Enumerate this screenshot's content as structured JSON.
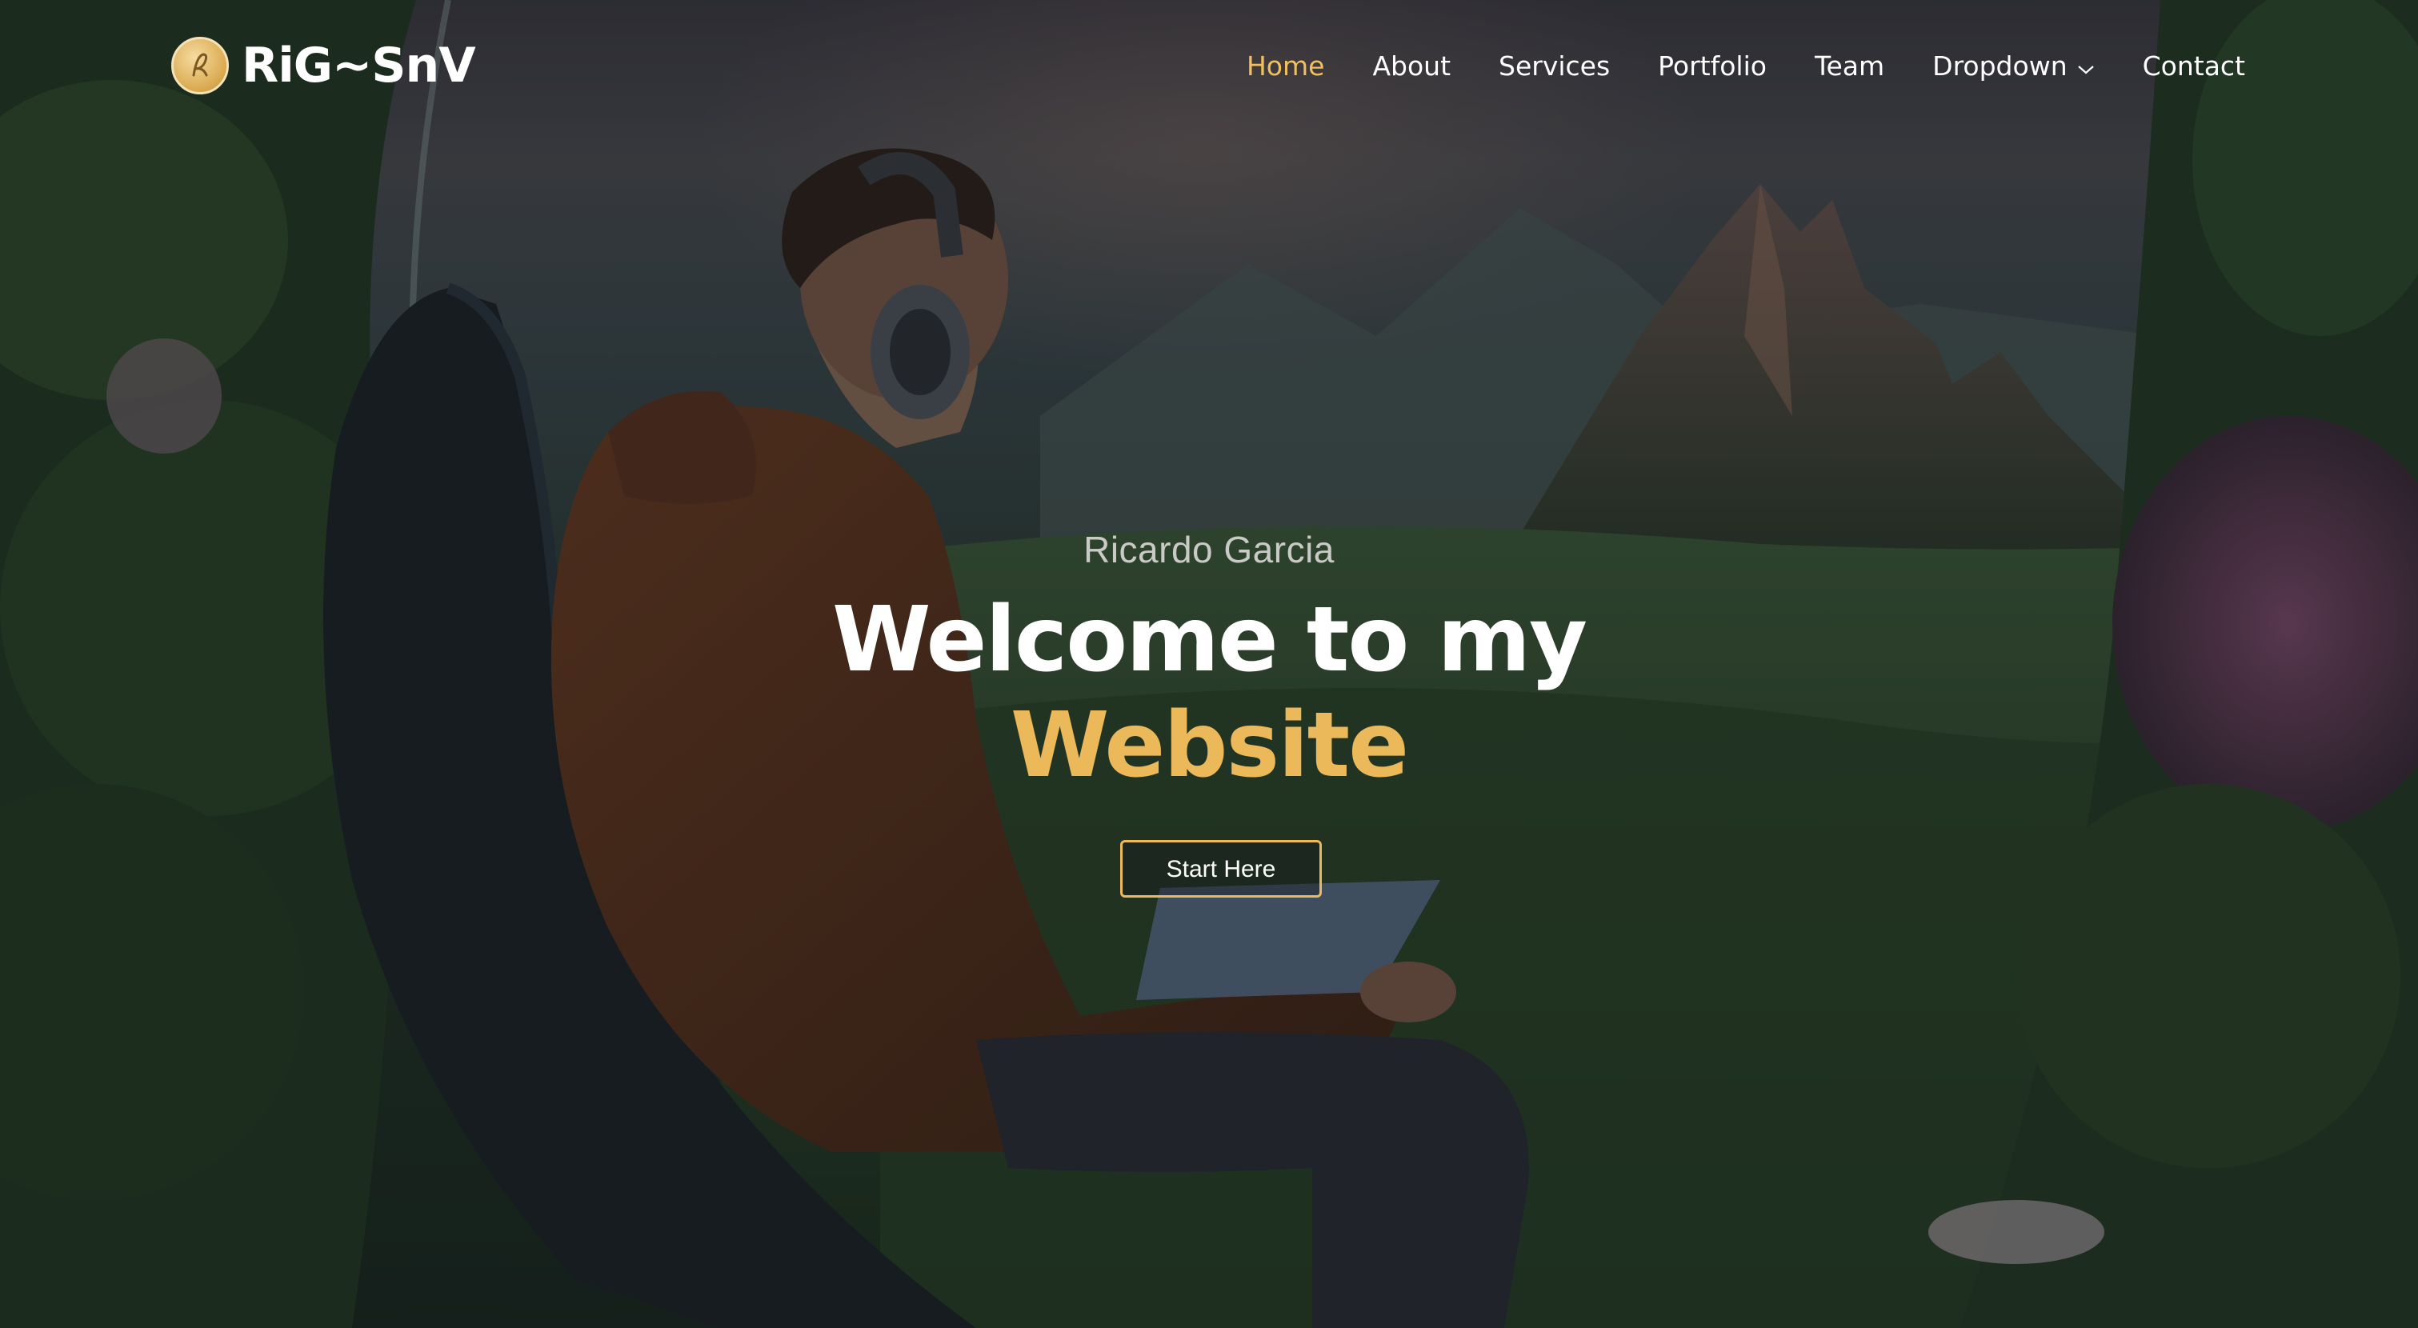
{
  "brand": {
    "name": "RiG~SnV",
    "accent": "#ebb95a",
    "logo_icon": "signature-badge-icon"
  },
  "nav": {
    "items": [
      {
        "label": "Home",
        "active": true
      },
      {
        "label": "About"
      },
      {
        "label": "Services"
      },
      {
        "label": "Portfolio"
      },
      {
        "label": "Team"
      },
      {
        "label": "Dropdown",
        "icon": "chevron-down-icon"
      },
      {
        "label": "Contact"
      }
    ],
    "active_color": "#f0c060"
  },
  "hero": {
    "subtitle": "Ricardo Garcia",
    "title_line1": "Welcome to my",
    "title_line2": "Website",
    "cta_label": "Start Here",
    "background_image": "man-with-headphones-in-chair-overlooking-fantasy-mountain-valley"
  }
}
